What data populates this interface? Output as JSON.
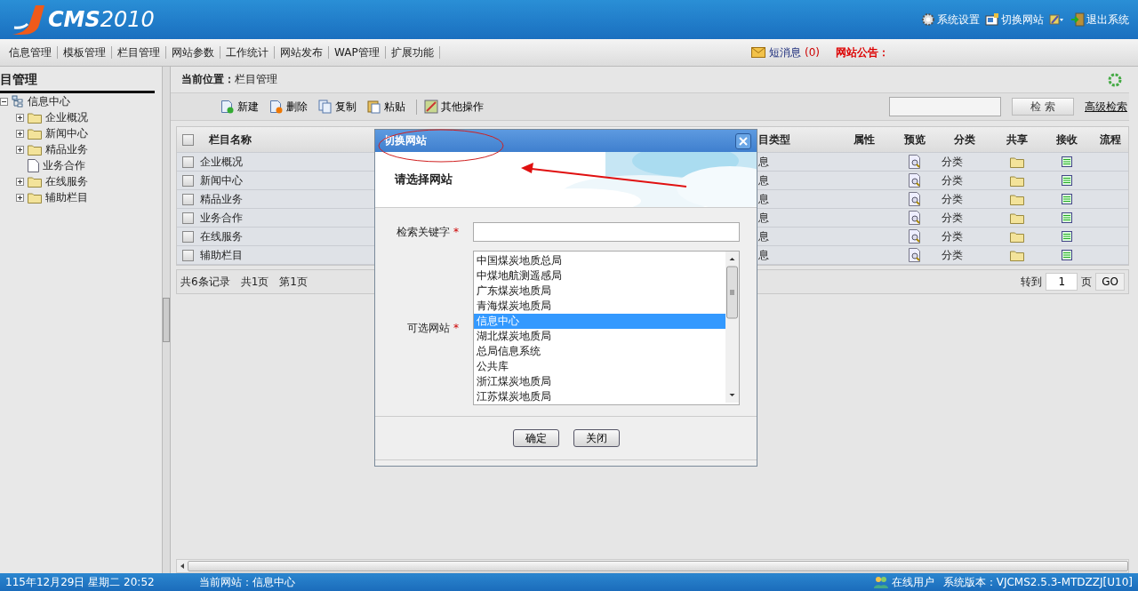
{
  "header": {
    "logo": "**CMS**2010",
    "links": [
      {
        "label": "系统设置",
        "kind": "gear"
      },
      {
        "label": "切换网站",
        "kind": "switch"
      },
      {
        "kind": "skin"
      },
      {
        "label": "退出系统",
        "kind": "exit"
      }
    ]
  },
  "menu": [
    "信息管理",
    "模板管理",
    "栏目管理",
    "网站参数",
    "工作统计",
    "网站发布",
    "WAP管理",
    "扩展功能"
  ],
  "messages": {
    "label": "短消息",
    "count": "(0)"
  },
  "notice": "网站公告：",
  "sidebar": {
    "title": "目管理",
    "tree": [
      {
        "label": "信息中心",
        "kind": "root",
        "expanded": true,
        "children": [
          {
            "label": "企业概况",
            "kind": "folder",
            "expanded": false
          },
          {
            "label": "新闻中心",
            "kind": "folder",
            "expanded": false
          },
          {
            "label": "精品业务",
            "kind": "folder",
            "expanded": false
          },
          {
            "label": "业务合作",
            "kind": "page"
          },
          {
            "label": "在线服务",
            "kind": "folder",
            "expanded": false
          },
          {
            "label": "辅助栏目",
            "kind": "folder",
            "expanded": false
          }
        ]
      }
    ]
  },
  "breadcrumb": {
    "label": "当前位置：",
    "value": "栏目管理"
  },
  "toolbar": [
    {
      "label": "新建",
      "kind": "new"
    },
    {
      "label": "删除",
      "kind": "delete"
    },
    {
      "label": "复制",
      "kind": "copy"
    },
    {
      "label": "粘贴",
      "kind": "paste"
    },
    {
      "label": "其他操作",
      "kind": "other"
    }
  ],
  "search": {
    "button": "检 索",
    "link": "高级检索"
  },
  "table": {
    "all_checked": false,
    "columns": [
      "栏目名称",
      "目类型",
      "属性",
      "预览",
      "分类",
      "共享",
      "接收",
      "流程"
    ],
    "rows": [
      {
        "checked": false,
        "name": "企业概况",
        "type": "息",
        "category": "分类"
      },
      {
        "checked": false,
        "name": "新闻中心",
        "type": "息",
        "category": "分类"
      },
      {
        "checked": false,
        "name": "精品业务",
        "type": "息",
        "category": "分类"
      },
      {
        "checked": false,
        "name": "业务合作",
        "type": "息",
        "category": "分类"
      },
      {
        "checked": false,
        "name": "在线服务",
        "type": "息",
        "category": "分类"
      },
      {
        "checked": false,
        "name": "辅助栏目",
        "type": "息",
        "category": "分类"
      }
    ]
  },
  "pager": {
    "records": "共6条记录",
    "pages": "共1页",
    "current": "第1页",
    "goto": "转到",
    "page": "1",
    "unit": "页",
    "go": "GO"
  },
  "dialog": {
    "title": "切换网站",
    "heading": "请选择网站",
    "keyword_label": "检索关键字",
    "sites_label": "可选网站",
    "required": "*",
    "sites": [
      {
        "label": "中国煤炭地质总局",
        "selected": false
      },
      {
        "label": "中煤地航测遥感局",
        "selected": false
      },
      {
        "label": "广东煤炭地质局",
        "selected": false
      },
      {
        "label": "青海煤炭地质局",
        "selected": false
      },
      {
        "label": "信息中心",
        "selected": true
      },
      {
        "label": "湖北煤炭地质局",
        "selected": false
      },
      {
        "label": "总局信息系统",
        "selected": false
      },
      {
        "label": "公共库",
        "selected": false
      },
      {
        "label": "浙江煤炭地质局",
        "selected": false
      },
      {
        "label": "江苏煤炭地质局",
        "selected": false
      }
    ],
    "buttons": [
      "确定",
      "关闭"
    ]
  },
  "status_bar": {
    "date": "115年12月29日 星期二 20:52",
    "site_label": "当前网站：",
    "site": "信息中心",
    "online": "在线用户",
    "version": "系统版本：VJCMS2.5.3-MTDZZJ[U10]"
  }
}
